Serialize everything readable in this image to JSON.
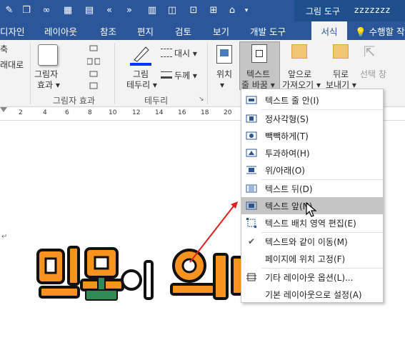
{
  "title_bar": {
    "context_group_title": "그림 도구",
    "extra_text": "ᴢᴢᴢᴢᴢᴢᴢ"
  },
  "tabs": {
    "design": "디자인",
    "layout": "레이아웃",
    "references": "참조",
    "mailings": "편지",
    "review": "검토",
    "view": "보기",
    "developer": "개발 도구",
    "format": "서식",
    "tell_me": "수행할 작"
  },
  "ribbon": {
    "reset": {
      "line1": "축",
      "line2": "래대로"
    },
    "picture_effects": {
      "line1": "그림자",
      "line2": "효과 ▾"
    },
    "group_shadow": "그림자 효과",
    "picture_border": {
      "line1": "그림",
      "line2": "테두리 ▾"
    },
    "dashes": "대시 ▾",
    "weight": "두께 ▾",
    "group_border": "테두리",
    "position": {
      "line1": "위치",
      "line2": "▾"
    },
    "wrap_text": {
      "line1": "텍스트",
      "line2": "줄 바꿈 ▾"
    },
    "bring_forward": {
      "line1": "앞으로",
      "line2": "가져오기 ▾"
    },
    "send_backward": {
      "line1": "뒤로",
      "line2": "보내기 ▾"
    },
    "selection_pane": "선택 창"
  },
  "ruler": {
    "numbers": [
      "2",
      "4",
      "6",
      "8",
      "10",
      "12",
      "14",
      "16",
      "18",
      "20"
    ]
  },
  "menu": {
    "items": [
      {
        "label": "텍스트 줄 안(I)",
        "icon": "inline-icon"
      },
      {
        "label": "정사각형(S)",
        "icon": "square-wrap-icon"
      },
      {
        "label": "빽빽하게(T)",
        "icon": "tight-wrap-icon"
      },
      {
        "label": "투과하여(H)",
        "icon": "through-wrap-icon"
      },
      {
        "label": "위/아래(O)",
        "icon": "top-bottom-wrap-icon"
      },
      {
        "label": "텍스트 뒤(D)",
        "icon": "behind-text-icon"
      },
      {
        "label": "텍스트 앞(N)",
        "icon": "in-front-of-text-icon"
      },
      {
        "label": "텍스트 배치 영역 편집(E)",
        "icon": "edit-wrap-points-icon"
      },
      {
        "label": "텍스트와 같이 이동(M)",
        "icon": "checkmark-icon"
      },
      {
        "label": "페이지에 위치 고정(F)",
        "icon": ""
      },
      {
        "label": "기타 레이아웃 옵션(L)...",
        "icon": "layout-options-icon"
      },
      {
        "label": "기본 레이아웃으로 설정(A)",
        "icon": ""
      }
    ]
  },
  "doc": {
    "paragraph_mark": "↵"
  },
  "colors": {
    "accent": "#2b579a",
    "highlight": "#c5c5c5",
    "logo_orange": "#f7931e",
    "arrow_red": "#e02020"
  }
}
